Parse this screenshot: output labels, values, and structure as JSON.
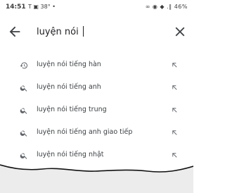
{
  "status_bar": {
    "time": "14:51",
    "notif": "T ▣ 38° •",
    "right": "∞ ◉ ◆ .∥ 46%"
  },
  "search": {
    "query": "luyện nói"
  },
  "suggestions": [
    {
      "icon": "history-icon",
      "text": "luyện nói tiếng hàn"
    },
    {
      "icon": "search-icon",
      "text": "luyện nói tiếng anh"
    },
    {
      "icon": "search-icon",
      "text": "luyện nói tiếng trung"
    },
    {
      "icon": "search-icon",
      "text": "luyện nói tiếng anh giao tiếp"
    },
    {
      "icon": "search-icon",
      "text": "luyện nói tiếng nhật"
    }
  ]
}
